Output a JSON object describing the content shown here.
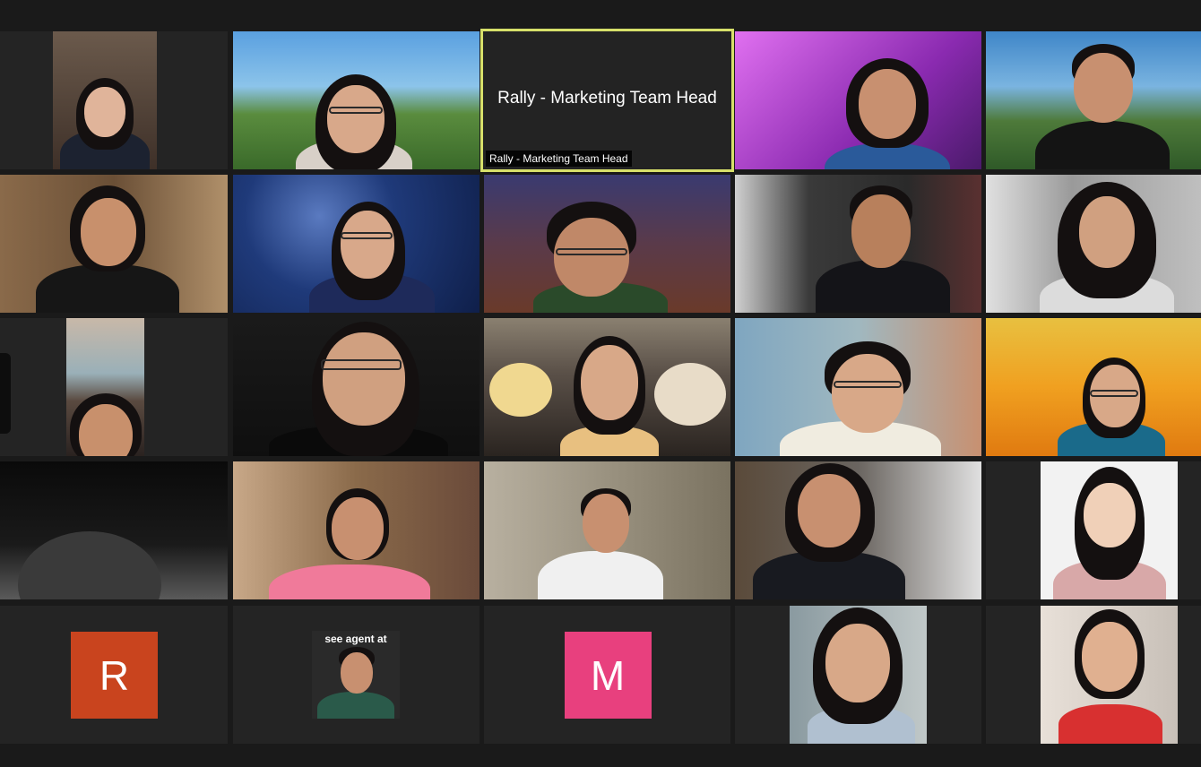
{
  "meeting": {
    "active_speaker_label": "Rally - Marketing Team Head",
    "active_speaker_center_name": "Rally - Marketing Team Head",
    "accent_color": "#d7e06a"
  },
  "participants": [
    {
      "kind": "video",
      "bg": "#5a4a40"
    },
    {
      "kind": "video",
      "bg": "#4f8fc8"
    },
    {
      "kind": "name",
      "name": "Rally - Marketing Team Head"
    },
    {
      "kind": "video",
      "bg": "#b84ad8"
    },
    {
      "kind": "video",
      "bg": "#3f86c8"
    },
    {
      "kind": "video",
      "bg": "#7a5a3c"
    },
    {
      "kind": "video",
      "bg": "#1f3f7a"
    },
    {
      "kind": "video",
      "bg": "#3a3550"
    },
    {
      "kind": "video",
      "bg": "#3a3a3a"
    },
    {
      "kind": "video",
      "bg": "#bfbfbf"
    },
    {
      "kind": "video",
      "bg": "#8a8070"
    },
    {
      "kind": "video",
      "bg": "#151515"
    },
    {
      "kind": "video",
      "bg": "#6f6a66"
    },
    {
      "kind": "video",
      "bg": "#7fa6c0"
    },
    {
      "kind": "video",
      "bg": "#e0a030"
    },
    {
      "kind": "video",
      "bg": "#0a0a0a"
    },
    {
      "kind": "video",
      "bg": "#8a6a4a"
    },
    {
      "kind": "video",
      "bg": "#9a9280"
    },
    {
      "kind": "video",
      "bg": "#6a6560"
    },
    {
      "kind": "video",
      "bg": "#f2f2f2"
    },
    {
      "kind": "initial",
      "initial": "R",
      "color": "#c9441e"
    },
    {
      "kind": "video",
      "bg": "#2a2a2a",
      "overlay_text": "see agent at"
    },
    {
      "kind": "initial",
      "initial": "M",
      "color": "#e8407e"
    },
    {
      "kind": "video",
      "bg": "#8a9aa0"
    },
    {
      "kind": "video",
      "bg": "#c8c0b8"
    }
  ]
}
